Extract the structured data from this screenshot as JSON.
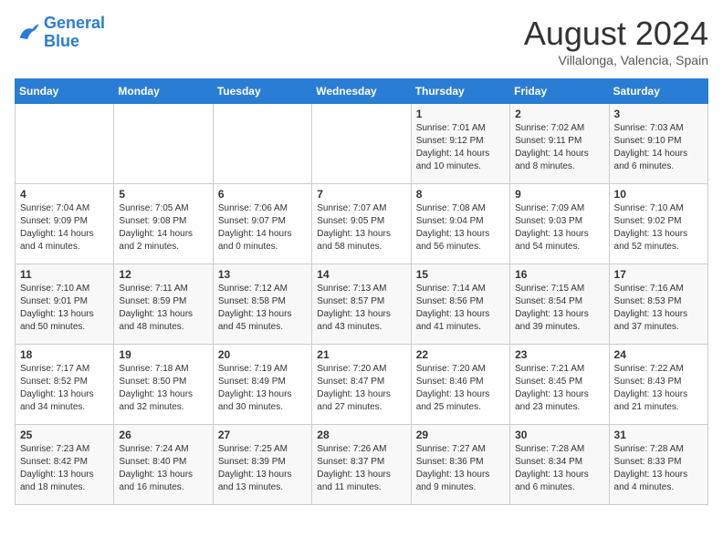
{
  "logo": {
    "line1": "General",
    "line2": "Blue"
  },
  "title": "August 2024",
  "location": "Villalonga, Valencia, Spain",
  "days_header": [
    "Sunday",
    "Monday",
    "Tuesday",
    "Wednesday",
    "Thursday",
    "Friday",
    "Saturday"
  ],
  "weeks": [
    [
      {
        "num": "",
        "info": ""
      },
      {
        "num": "",
        "info": ""
      },
      {
        "num": "",
        "info": ""
      },
      {
        "num": "",
        "info": ""
      },
      {
        "num": "1",
        "info": "Sunrise: 7:01 AM\nSunset: 9:12 PM\nDaylight: 14 hours\nand 10 minutes."
      },
      {
        "num": "2",
        "info": "Sunrise: 7:02 AM\nSunset: 9:11 PM\nDaylight: 14 hours\nand 8 minutes."
      },
      {
        "num": "3",
        "info": "Sunrise: 7:03 AM\nSunset: 9:10 PM\nDaylight: 14 hours\nand 6 minutes."
      }
    ],
    [
      {
        "num": "4",
        "info": "Sunrise: 7:04 AM\nSunset: 9:09 PM\nDaylight: 14 hours\nand 4 minutes."
      },
      {
        "num": "5",
        "info": "Sunrise: 7:05 AM\nSunset: 9:08 PM\nDaylight: 14 hours\nand 2 minutes."
      },
      {
        "num": "6",
        "info": "Sunrise: 7:06 AM\nSunset: 9:07 PM\nDaylight: 14 hours\nand 0 minutes."
      },
      {
        "num": "7",
        "info": "Sunrise: 7:07 AM\nSunset: 9:05 PM\nDaylight: 13 hours\nand 58 minutes."
      },
      {
        "num": "8",
        "info": "Sunrise: 7:08 AM\nSunset: 9:04 PM\nDaylight: 13 hours\nand 56 minutes."
      },
      {
        "num": "9",
        "info": "Sunrise: 7:09 AM\nSunset: 9:03 PM\nDaylight: 13 hours\nand 54 minutes."
      },
      {
        "num": "10",
        "info": "Sunrise: 7:10 AM\nSunset: 9:02 PM\nDaylight: 13 hours\nand 52 minutes."
      }
    ],
    [
      {
        "num": "11",
        "info": "Sunrise: 7:10 AM\nSunset: 9:01 PM\nDaylight: 13 hours\nand 50 minutes."
      },
      {
        "num": "12",
        "info": "Sunrise: 7:11 AM\nSunset: 8:59 PM\nDaylight: 13 hours\nand 48 minutes."
      },
      {
        "num": "13",
        "info": "Sunrise: 7:12 AM\nSunset: 8:58 PM\nDaylight: 13 hours\nand 45 minutes."
      },
      {
        "num": "14",
        "info": "Sunrise: 7:13 AM\nSunset: 8:57 PM\nDaylight: 13 hours\nand 43 minutes."
      },
      {
        "num": "15",
        "info": "Sunrise: 7:14 AM\nSunset: 8:56 PM\nDaylight: 13 hours\nand 41 minutes."
      },
      {
        "num": "16",
        "info": "Sunrise: 7:15 AM\nSunset: 8:54 PM\nDaylight: 13 hours\nand 39 minutes."
      },
      {
        "num": "17",
        "info": "Sunrise: 7:16 AM\nSunset: 8:53 PM\nDaylight: 13 hours\nand 37 minutes."
      }
    ],
    [
      {
        "num": "18",
        "info": "Sunrise: 7:17 AM\nSunset: 8:52 PM\nDaylight: 13 hours\nand 34 minutes."
      },
      {
        "num": "19",
        "info": "Sunrise: 7:18 AM\nSunset: 8:50 PM\nDaylight: 13 hours\nand 32 minutes."
      },
      {
        "num": "20",
        "info": "Sunrise: 7:19 AM\nSunset: 8:49 PM\nDaylight: 13 hours\nand 30 minutes."
      },
      {
        "num": "21",
        "info": "Sunrise: 7:20 AM\nSunset: 8:47 PM\nDaylight: 13 hours\nand 27 minutes."
      },
      {
        "num": "22",
        "info": "Sunrise: 7:20 AM\nSunset: 8:46 PM\nDaylight: 13 hours\nand 25 minutes."
      },
      {
        "num": "23",
        "info": "Sunrise: 7:21 AM\nSunset: 8:45 PM\nDaylight: 13 hours\nand 23 minutes."
      },
      {
        "num": "24",
        "info": "Sunrise: 7:22 AM\nSunset: 8:43 PM\nDaylight: 13 hours\nand 21 minutes."
      }
    ],
    [
      {
        "num": "25",
        "info": "Sunrise: 7:23 AM\nSunset: 8:42 PM\nDaylight: 13 hours\nand 18 minutes."
      },
      {
        "num": "26",
        "info": "Sunrise: 7:24 AM\nSunset: 8:40 PM\nDaylight: 13 hours\nand 16 minutes."
      },
      {
        "num": "27",
        "info": "Sunrise: 7:25 AM\nSunset: 8:39 PM\nDaylight: 13 hours\nand 13 minutes."
      },
      {
        "num": "28",
        "info": "Sunrise: 7:26 AM\nSunset: 8:37 PM\nDaylight: 13 hours\nand 11 minutes."
      },
      {
        "num": "29",
        "info": "Sunrise: 7:27 AM\nSunset: 8:36 PM\nDaylight: 13 hours\nand 9 minutes."
      },
      {
        "num": "30",
        "info": "Sunrise: 7:28 AM\nSunset: 8:34 PM\nDaylight: 13 hours\nand 6 minutes."
      },
      {
        "num": "31",
        "info": "Sunrise: 7:28 AM\nSunset: 8:33 PM\nDaylight: 13 hours\nand 4 minutes."
      }
    ]
  ]
}
